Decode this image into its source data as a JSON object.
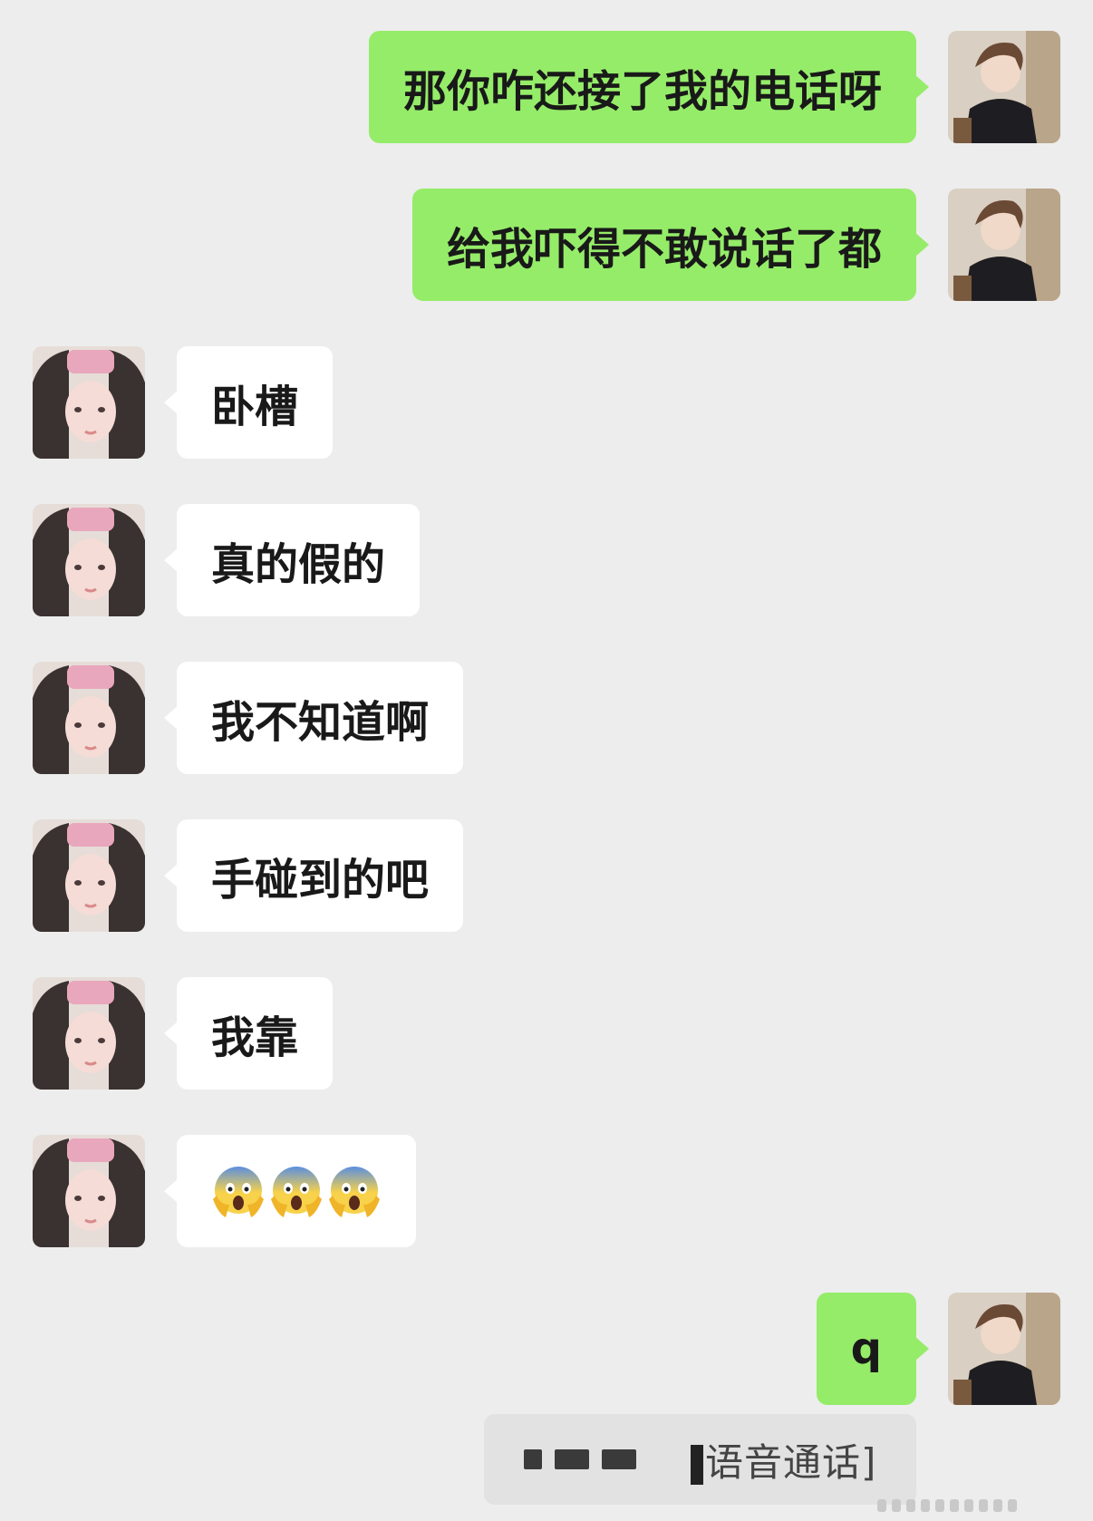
{
  "chat": {
    "messages": [
      {
        "side": "right",
        "text": "那你咋还接了我的电话呀"
      },
      {
        "side": "right",
        "text": "给我吓得不敢说话了都"
      },
      {
        "side": "left",
        "text": "卧槽"
      },
      {
        "side": "left",
        "text": "真的假的"
      },
      {
        "side": "left",
        "text": "我不知道啊"
      },
      {
        "side": "left",
        "text": "手碰到的吧"
      },
      {
        "side": "left",
        "text": "我靠"
      },
      {
        "side": "left",
        "text": "",
        "emoji": "screaming-face-emoji",
        "emoji_count": 3
      },
      {
        "side": "right",
        "text": "q"
      }
    ],
    "voice_call": {
      "label": "语音通话]"
    }
  },
  "colors": {
    "background": "#ededed",
    "sent_bubble": "#95ec69",
    "received_bubble": "#ffffff",
    "text": "#191919"
  }
}
